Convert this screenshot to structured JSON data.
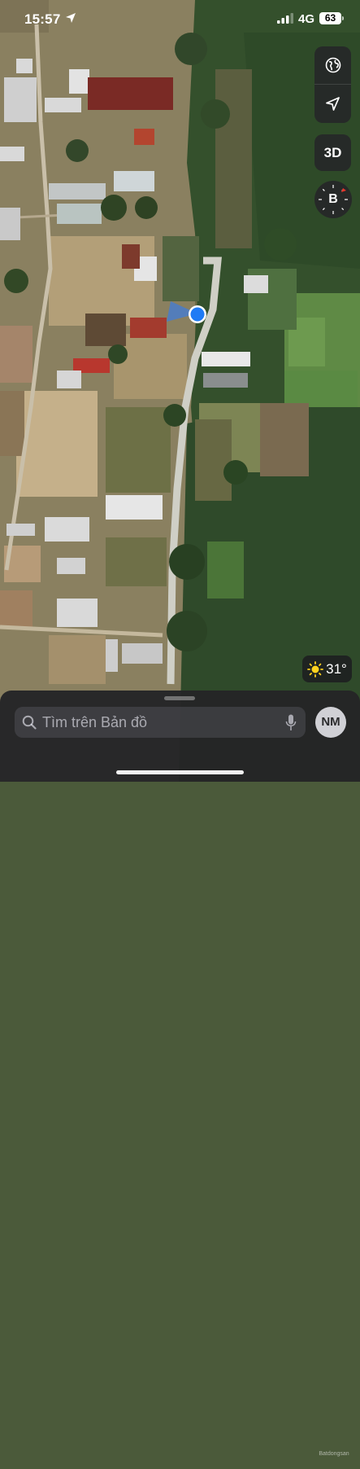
{
  "status_bar": {
    "time": "15:57",
    "network": "4G",
    "battery": "63"
  },
  "map": {
    "view": "satellite"
  },
  "controls": {
    "globe": "globe-icon",
    "location": "location-arrow-icon",
    "mode_3d": "3D",
    "compass_letter": "B"
  },
  "weather": {
    "temperature": "31°",
    "icon": "sun-icon"
  },
  "search": {
    "placeholder": "Tìm trên Bản đồ"
  },
  "profile": {
    "initials": "NM"
  },
  "watermark": "Batdongsan"
}
